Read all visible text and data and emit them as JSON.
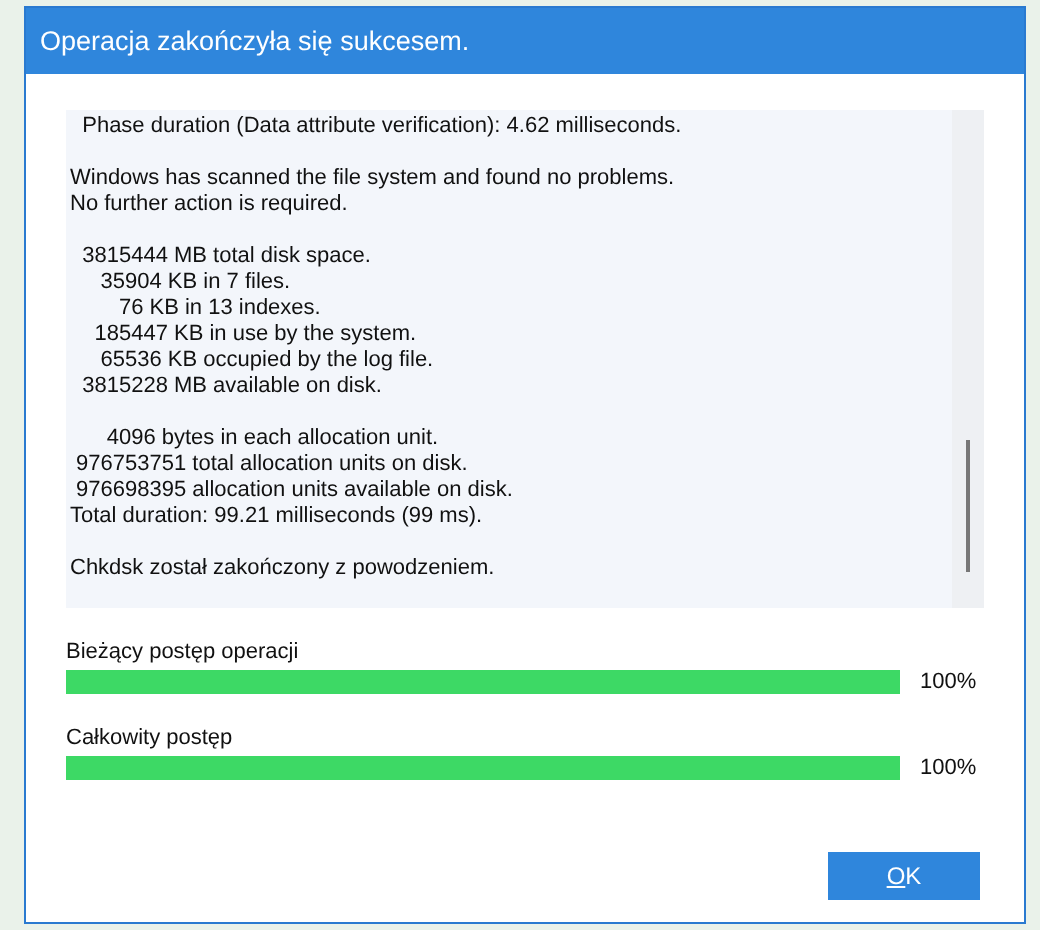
{
  "window": {
    "title": "Operacja zakończyła się sukcesem."
  },
  "log": [
    [
      "  Phase duration (Data attribute verification): 4.62 milliseconds."
    ],
    [
      "Windows has scanned the file system and found no problems.",
      "No further action is required."
    ],
    [
      "  3815444 MB total disk space.",
      "     35904 KB in 7 files.",
      "        76 KB in 13 indexes.",
      "    185447 KB in use by the system.",
      "     65536 KB occupied by the log file.",
      "  3815228 MB available on disk."
    ],
    [
      "      4096 bytes in each allocation unit.",
      " 976753751 total allocation units on disk.",
      " 976698395 allocation units available on disk.",
      "Total duration: 99.21 milliseconds (99 ms)."
    ],
    [
      "Chkdsk został zakończony z powodzeniem."
    ]
  ],
  "progress": [
    {
      "label": "Bieżący postęp operacji",
      "level": 1,
      "reading": "100%"
    },
    {
      "label": "Całkowity postęp",
      "level": 1,
      "reading": "100%"
    }
  ],
  "buttons": [
    "OK"
  ]
}
